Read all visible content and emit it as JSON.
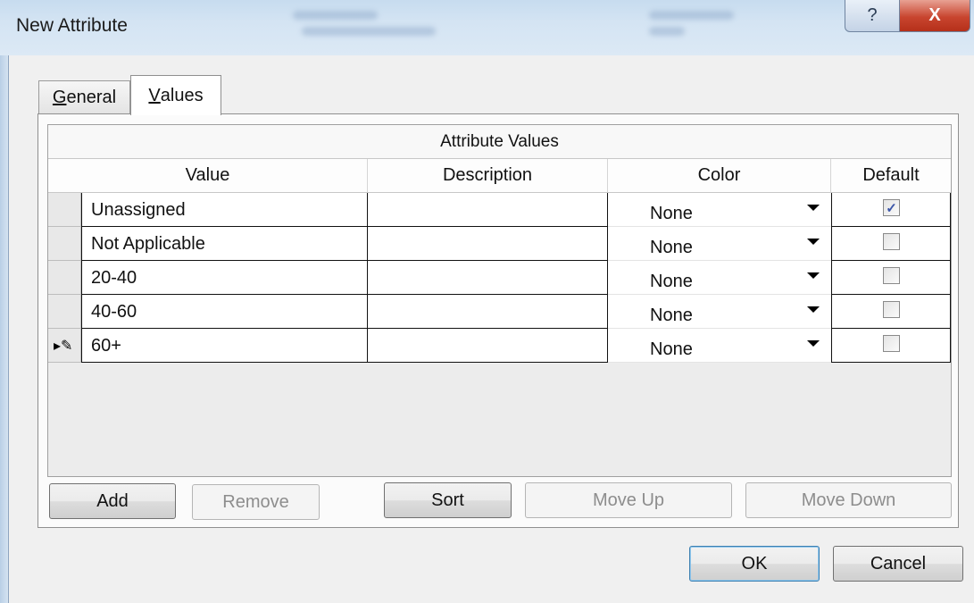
{
  "window": {
    "title": "New Attribute",
    "help_glyph": "?",
    "close_glyph": "X"
  },
  "tabs": [
    {
      "label": "General",
      "accel": "G",
      "rest": "eneral",
      "active": false
    },
    {
      "label": "Values",
      "accel": "V",
      "rest": "alues",
      "active": true
    }
  ],
  "grid": {
    "caption": "Attribute Values",
    "columns": [
      "Value",
      "Description",
      "Color",
      "Default"
    ],
    "rows": [
      {
        "value": "Unassigned",
        "description": "",
        "color": "None",
        "default": true
      },
      {
        "value": "Not Applicable",
        "description": "",
        "color": "None",
        "default": false
      },
      {
        "value": "20-40",
        "description": "",
        "color": "None",
        "default": false
      },
      {
        "value": "40-60",
        "description": "",
        "color": "None",
        "default": false
      },
      {
        "value": "60+",
        "description": "",
        "color": "None",
        "default": false,
        "editing": true
      }
    ]
  },
  "actions": {
    "add": "Add",
    "remove": "Remove",
    "sort": "Sort",
    "move_up": "Move Up",
    "move_down": "Move Down"
  },
  "dialog": {
    "ok": "OK",
    "cancel": "Cancel"
  },
  "icons": {
    "edit_row": "pencil-icon",
    "dropdown": "chevron-down-icon",
    "check": "checkmark-icon"
  },
  "colors": {
    "close_red": "#c8452f",
    "title_glass": "#d4e4f3",
    "check_blue": "#3b55a8",
    "focus_blue": "#3c7fb1"
  }
}
